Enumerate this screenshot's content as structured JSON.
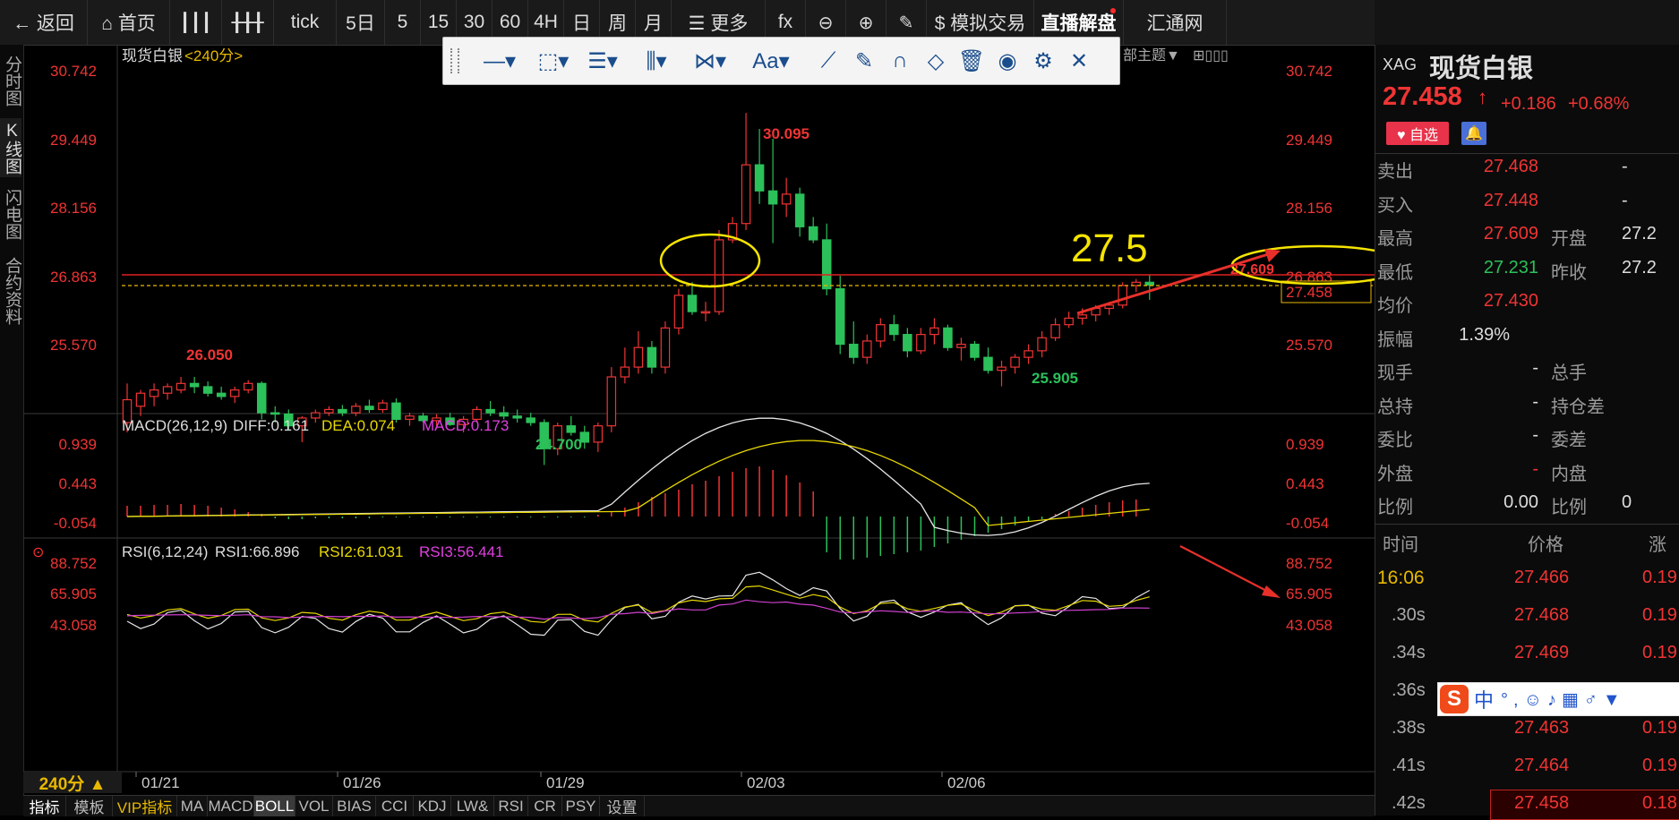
{
  "toolbar": {
    "items": [
      {
        "label": "← 返回",
        "icon": "back-arrow-icon"
      },
      {
        "label": "⌂ 首页",
        "icon": "home-icon"
      },
      {
        "label": "",
        "icon": "bar-chart-icon"
      },
      {
        "label": "",
        "icon": "candlestick-icon"
      },
      {
        "label": "tick"
      },
      {
        "label": "5日"
      },
      {
        "label": "5"
      },
      {
        "label": "15"
      },
      {
        "label": "30"
      },
      {
        "label": "60"
      },
      {
        "label": "4H"
      },
      {
        "label": "日"
      },
      {
        "label": "周"
      },
      {
        "label": "月"
      },
      {
        "label": "☰ 更多",
        "icon": "list-icon"
      },
      {
        "label": "fx",
        "icon": "fx-icon"
      },
      {
        "label": "",
        "icon": "zoom-out-icon"
      },
      {
        "label": "",
        "icon": "zoom-in-icon"
      },
      {
        "label": "",
        "icon": "pen-icon"
      },
      {
        "label": "$ 模拟交易",
        "icon": "dollar-icon"
      },
      {
        "label": "直播解盘"
      },
      {
        "label": "汇通网",
        "icon": "logo-icon"
      }
    ]
  },
  "left_tabs": [
    "分时图",
    "K线图",
    "闪电图",
    "合约资料"
  ],
  "drawing_tools": [
    "line-tool-icon",
    "rect-tool-icon",
    "fib-tool-icon",
    "period-tool-icon",
    "pattern-tool-icon",
    "text-tool-icon",
    "ruler-icon",
    "brush-icon",
    "magnet-icon",
    "eraser-icon",
    "trash-icon",
    "eye-icon",
    "gear-icon",
    "close-icon"
  ],
  "drawing_text_tool": "Aa",
  "hidden_theme_text": "部主题▼",
  "chart": {
    "title": "现货白银",
    "period_tag": "<240分>",
    "price_ticks": [
      "30.742",
      "29.449",
      "28.156",
      "26.863",
      "25.570"
    ],
    "current_price_label": "27.458",
    "annot_high": "30.095",
    "annot_start_high": "26.050",
    "annot_low1": "24.700",
    "annot_low2": "25.905",
    "annot_recent_high": "27.609",
    "big_annotation": "27.5",
    "dates": [
      "01/21",
      "01/26",
      "01/29",
      "02/03",
      "02/06"
    ],
    "colors": {
      "up": "#f03434",
      "down": "#2cc05a",
      "annot": "#f5e400"
    }
  },
  "macd": {
    "title": "MACD(26,12,9)",
    "diff": "DIFF:0.161",
    "dea": "DEA:0.074",
    "macd": "MACD:0.173",
    "ticks": [
      "0.939",
      "0.443",
      "-0.054"
    ]
  },
  "rsi": {
    "title": "RSI(6,12,24)",
    "rsi1": "RSI1:66.896",
    "rsi2": "RSI2:61.031",
    "rsi3": "RSI3:56.441",
    "ticks": [
      "88.752",
      "65.905",
      "43.058"
    ]
  },
  "period_button": "240分 ▲",
  "bottom_tabs": [
    "指标",
    "模板",
    "VIP指标",
    "MA",
    "MACD",
    "BOLL",
    "VOL",
    "BIAS",
    "CCI",
    "KDJ",
    "LW&",
    "RSI",
    "CR",
    "PSY",
    "设置"
  ],
  "quote": {
    "symbol_code": "XAG",
    "symbol_name": "现货白银",
    "last": "27.458",
    "arrow": "↑",
    "change": "+0.186",
    "change_pct": "+0.68%",
    "fav_label": "♥ 自选",
    "rows": [
      {
        "l": "卖出",
        "v": "27.468",
        "l2": "",
        "v2": "-"
      },
      {
        "l": "买入",
        "v": "27.448",
        "l2": "",
        "v2": "-"
      },
      {
        "l": "最高",
        "v": "27.609",
        "l2": "开盘",
        "v2": "27.2"
      },
      {
        "l": "最低",
        "v": "27.231",
        "l2": "昨收",
        "v2": "27.2"
      },
      {
        "l": "均价",
        "v": "27.430",
        "l2": "",
        "v2": ""
      },
      {
        "l": "振幅",
        "v": "1.39%",
        "l2": "",
        "v2": ""
      },
      {
        "l": "现手",
        "v": "-",
        "l2": "总手",
        "v2": ""
      },
      {
        "l": "总持",
        "v": "-",
        "l2": "持仓差",
        "v2": ""
      },
      {
        "l": "委比",
        "v": "-",
        "l2": "委差",
        "v2": ""
      },
      {
        "l": "外盘",
        "v": "-",
        "l2": "内盘",
        "v2": ""
      },
      {
        "l": "比例",
        "v": "0.00",
        "l2": "比例",
        "v2": "0"
      }
    ],
    "ticks_header": {
      "time": "时间",
      "price": "价格",
      "chg": "涨"
    },
    "ticks": [
      {
        "t": "16:06",
        "p": "27.466",
        "c": "0.19"
      },
      {
        "t": ".30s",
        "p": "27.468",
        "c": "0.19"
      },
      {
        "t": ".34s",
        "p": "27.469",
        "c": "0.19"
      },
      {
        "t": ".36s",
        "p": "",
        "c": ""
      },
      {
        "t": ".38s",
        "p": "27.463",
        "c": "0.19"
      },
      {
        "t": ".41s",
        "p": "27.464",
        "c": "0.19"
      },
      {
        "t": ".42s",
        "p": "27.458",
        "c": "0.18"
      }
    ],
    "ime_label": "中"
  }
}
